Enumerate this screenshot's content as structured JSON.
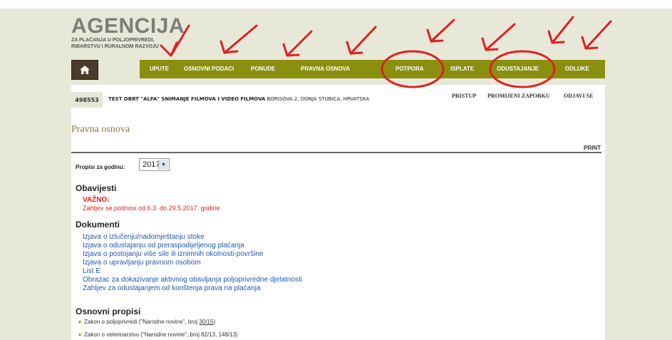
{
  "logo": {
    "title": "AGENCIJA",
    "line1": "ZA PLAĆANJA U POLJOPRIVREDI,",
    "line2": "RIBARSTVU I RURALNOM RAZVOJU"
  },
  "nav": {
    "home_icon": "home-icon",
    "items": [
      "UPUTE",
      "OSNOVNI PODACI",
      "PONUDE",
      "PRAVNA OSNOVA",
      "POTPORA",
      "ISPLATE",
      "ODUSTAJANJE",
      "ODLUKE"
    ]
  },
  "user": {
    "id": "498553",
    "business_name": "TEST OBRT \"ALFA\" SNIMANJE FILMOVA I VIDEO FILMOVA",
    "address": "BORISOVA 2, DONJA STUBICA, HRVATSKA"
  },
  "account_links": [
    "PRISTUP",
    "PROMIJENI ZAPORKU",
    "ODJAVI SE"
  ],
  "page": {
    "title": "Pravna osnova",
    "print": "PRINT"
  },
  "filter": {
    "label": "Propisi za godinu:",
    "year": "2017"
  },
  "notices": {
    "heading": "Obavijesti",
    "strong": "VAŽNO:",
    "text": "Zahtjev se podnosi od 6.3. do 29.5.2017. godine."
  },
  "documents": {
    "heading": "Dokumenti",
    "items": [
      "Izjava o izlučenju/nadomještanju stoke",
      "Izjava o odustajanju od preraspodijeljenog plaćanja",
      "Izjava o postojanju više sile ili iznimnih okolnosti-površine",
      "Izjava o upravljanju pravnom osobom",
      "List E",
      "Obrazac za dokazivanje aktivnog obavljanja poljoprivredne djelatnosti",
      "Zahtjev za odustajanjem od korištenja prava na plaćanja"
    ]
  },
  "basic_regulations": {
    "heading": "Osnovni propisi",
    "items": [
      {
        "prefix": "Zakon o poljoprivredi (\"Narodne novine\", broj ",
        "link": "30/15",
        "suffix": ")"
      },
      {
        "prefix": "Zakon o veterinarstvu (\"Narodne novine\", broj 82/13, 148/13)",
        "link": "",
        "suffix": ""
      }
    ]
  },
  "colors": {
    "nav_bg": "#8b8f0e",
    "home_bg": "#4a3b2a",
    "link": "#2156b8",
    "alert": "#e0201a",
    "annotation": "#e02020"
  }
}
